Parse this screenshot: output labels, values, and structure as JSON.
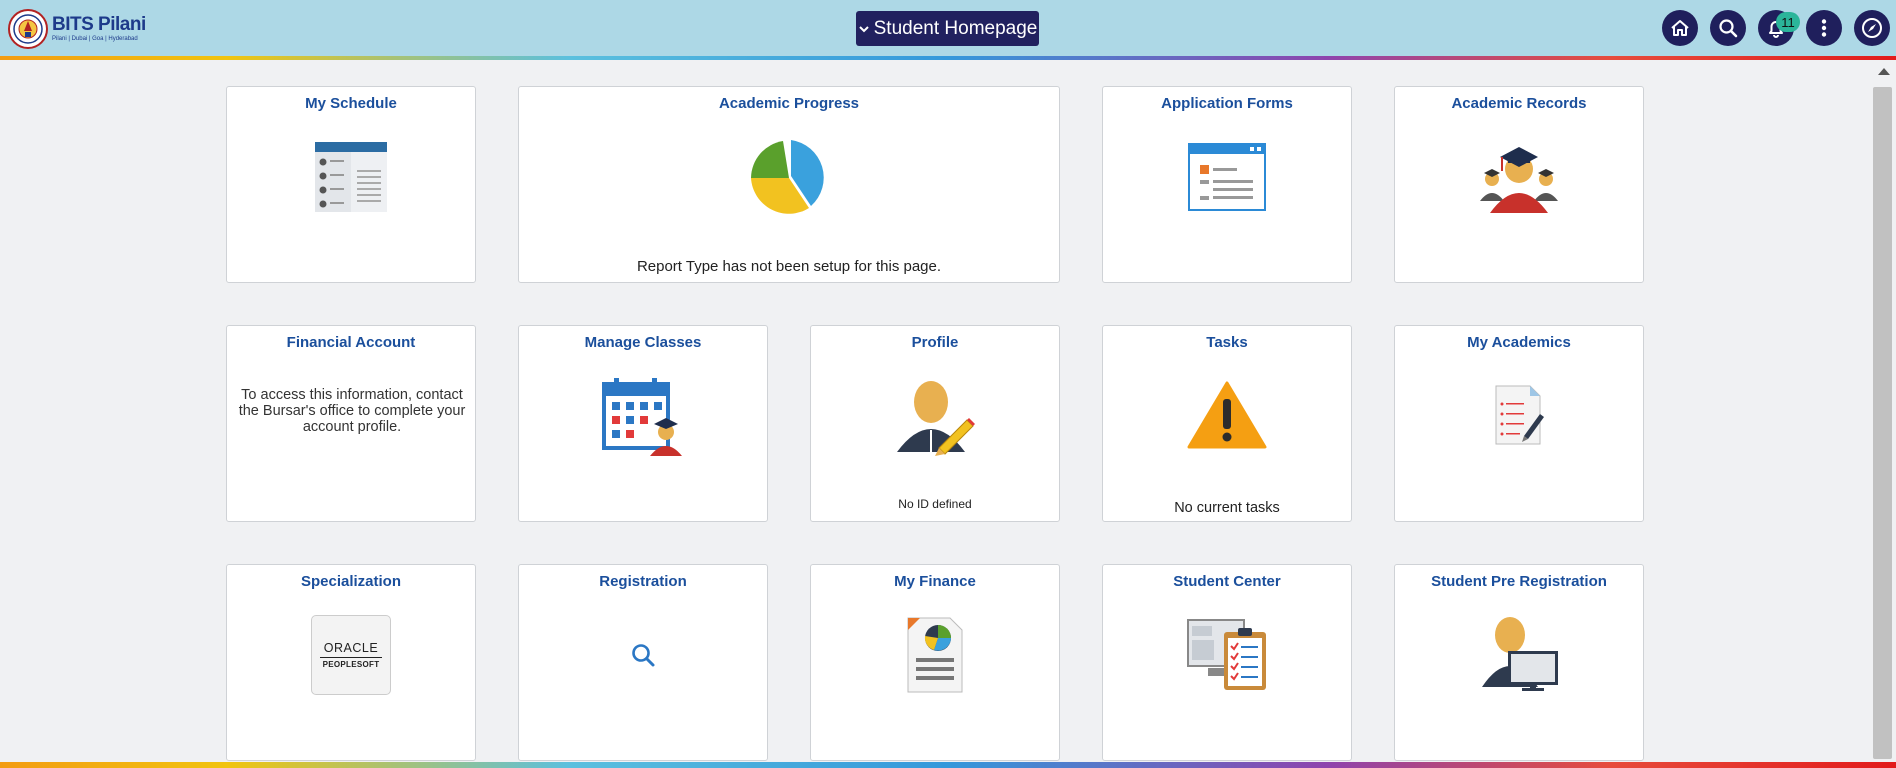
{
  "header": {
    "logo_name": "BITS Pilani",
    "logo_sub": "Pilani | Dubai | Goa | Hyderabad",
    "title": "Student Homepage",
    "notification_count": "11",
    "icons": [
      "home-icon",
      "search-icon",
      "bell-icon",
      "more-vertical-icon",
      "navbar-compass-icon"
    ]
  },
  "tiles": [
    {
      "title": "My Schedule"
    },
    {
      "title": "Academic Progress",
      "message": "Report Type has not been setup for this page."
    },
    {
      "title": "Application Forms"
    },
    {
      "title": "Academic Records"
    },
    {
      "title": "Financial Account",
      "message": "To access this information, contact the Bursar's office to complete your account profile."
    },
    {
      "title": "Manage Classes"
    },
    {
      "title": "Profile",
      "message": "No ID defined"
    },
    {
      "title": "Tasks",
      "message": "No current tasks"
    },
    {
      "title": "My Academics"
    },
    {
      "title": "Specialization",
      "logo_line1": "ORACLE",
      "logo_line2": "PEOPLESOFT"
    },
    {
      "title": "Registration"
    },
    {
      "title": "My Finance"
    },
    {
      "title": "Student Center"
    },
    {
      "title": "Student Pre Registration"
    }
  ],
  "colors": {
    "header_bg": "#add8e6",
    "title_button": "#21215f",
    "tile_title": "#1b4f9c",
    "badge": "#2bb59a"
  }
}
